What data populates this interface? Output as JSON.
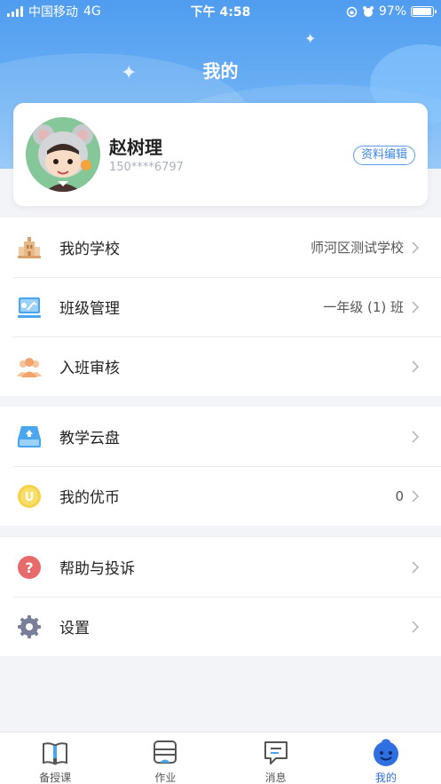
{
  "status_bar": {
    "carrier": "中国移动",
    "network": "4G",
    "time": "下午 4:58",
    "battery_percent": "97%",
    "battery_level": 0.97
  },
  "page_title": "我的",
  "profile": {
    "name": "赵树理",
    "phone": "150****6797",
    "edit_label": "资料编辑"
  },
  "menu_groups": [
    [
      {
        "label": "我的学校",
        "value": "师河区测试学校",
        "icon": "school-building-icon",
        "icon_color": "#d9a06b"
      },
      {
        "label": "班级管理",
        "value": "一年级 (1) 班",
        "icon": "classroom-board-icon",
        "icon_color": "#4aa6ee"
      },
      {
        "label": "入班审核",
        "value": "",
        "icon": "users-icon",
        "icon_color": "#f0a36b"
      }
    ],
    [
      {
        "label": "教学云盘",
        "value": "",
        "icon": "cloud-drive-icon",
        "icon_color": "#4aa6ee"
      },
      {
        "label": "我的优币",
        "value": "0",
        "icon": "coin-icon",
        "icon_color": "#f6d24a"
      }
    ],
    [
      {
        "label": "帮助与投诉",
        "value": "",
        "icon": "help-icon",
        "icon_color": "#e86a6a"
      },
      {
        "label": "设置",
        "value": "",
        "icon": "gear-icon",
        "icon_color": "#7a7f99"
      }
    ]
  ],
  "tabs": [
    {
      "label": "备授课",
      "icon": "book-icon"
    },
    {
      "label": "作业",
      "icon": "homework-icon"
    },
    {
      "label": "消息",
      "icon": "message-icon"
    },
    {
      "label": "我的",
      "icon": "profile-face-icon",
      "active": true
    }
  ],
  "colors": {
    "header_blue": "#4f9cf0",
    "accent": "#2f6fe0",
    "background": "#f3f4f8"
  }
}
